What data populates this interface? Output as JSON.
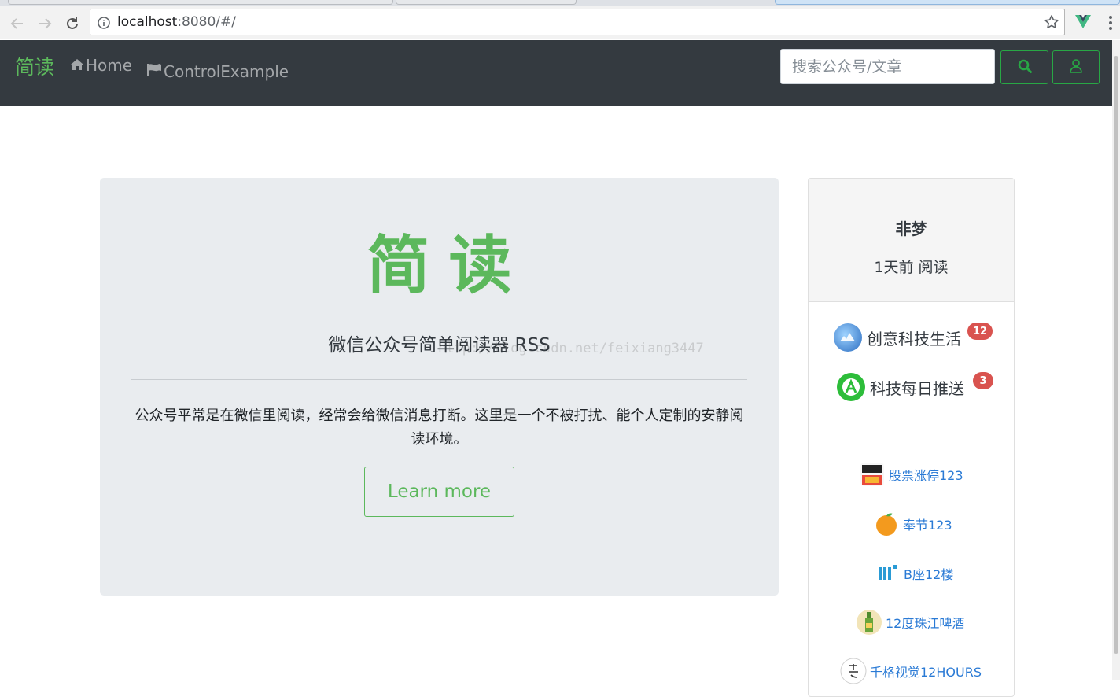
{
  "browser": {
    "url_host": "localhost",
    "url_rest": ":8080/#/",
    "icons": [
      "back-icon",
      "forward-icon",
      "reload-icon",
      "info-icon",
      "star-icon",
      "vue-devtools-icon",
      "menu-icon"
    ]
  },
  "navbar": {
    "brand": "简读",
    "links": [
      {
        "label": "Home",
        "icon": "home-icon"
      },
      {
        "label": "ControlExample",
        "icon": "flag-icon"
      }
    ],
    "search_placeholder": "搜索公众号/文章",
    "buttons": [
      {
        "icon": "search-icon"
      },
      {
        "icon": "user-icon"
      }
    ],
    "accent_color": "#28a745",
    "background_color": "#343a40"
  },
  "jumbotron": {
    "title": "简读",
    "lead": "微信公众号简单阅读器 RSS",
    "watermark": "http://blog.csdn.net/feixiang3447",
    "description": "公众号平常是在微信里阅读，经常会给微信消息打断。这里是一个不被打扰、能个人定制的安静阅读环境。",
    "button_label": "Learn more",
    "title_color": "#5cb85c"
  },
  "profile": {
    "name": "非梦",
    "last_read": "1天前 阅读"
  },
  "subscriptions": [
    {
      "name": "创意科技生活",
      "unread": "12"
    },
    {
      "name": "科技每日推送",
      "unread": "3"
    }
  ],
  "recommendations": [
    {
      "name": "股票涨停123"
    },
    {
      "name": "奉节123"
    },
    {
      "name": "B座12楼"
    },
    {
      "name": "12度珠江啤酒"
    },
    {
      "name": "千格视觉12HOURS"
    }
  ],
  "badge_color": "#d9534f",
  "link_color": "#2a7ad5"
}
